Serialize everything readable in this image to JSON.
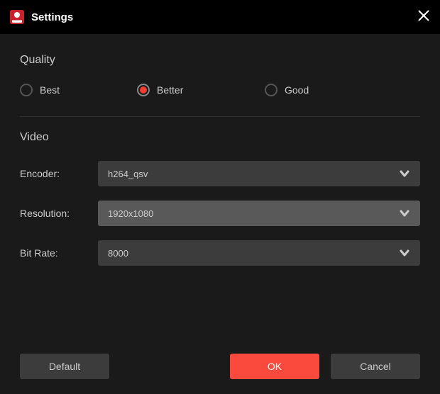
{
  "header": {
    "title": "Settings"
  },
  "quality": {
    "section_title": "Quality",
    "options": {
      "best": "Best",
      "better": "Better",
      "good": "Good"
    },
    "selected": "better"
  },
  "video": {
    "section_title": "Video",
    "encoder": {
      "label": "Encoder:",
      "value": "h264_qsv"
    },
    "resolution": {
      "label": "Resolution:",
      "value": "1920x1080"
    },
    "bitrate": {
      "label": "Bit Rate:",
      "value": "8000"
    }
  },
  "footer": {
    "default_label": "Default",
    "ok_label": "OK",
    "cancel_label": "Cancel"
  }
}
